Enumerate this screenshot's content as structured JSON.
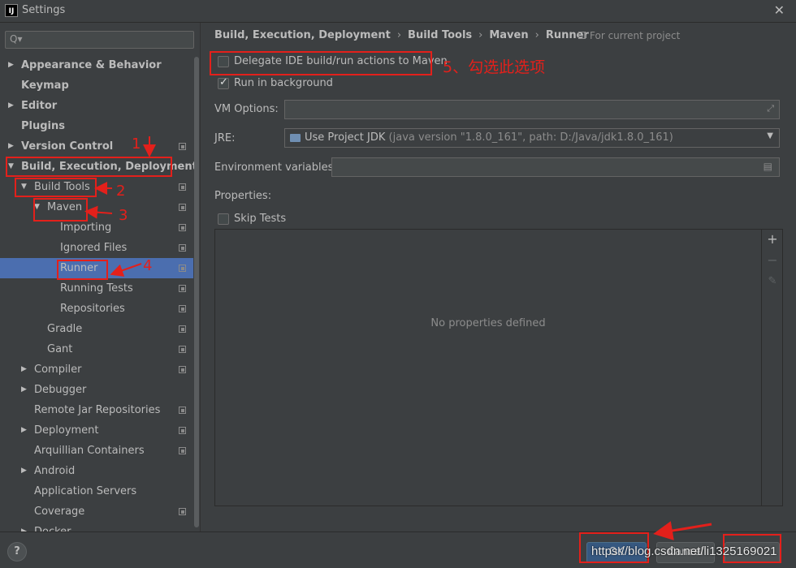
{
  "window": {
    "title": "Settings",
    "app_icon": "IJ",
    "close_glyph": "✕"
  },
  "search": {
    "placeholder": "",
    "icon": "Q▾"
  },
  "tree": [
    {
      "label": "Appearance & Behavior",
      "arrow": "▶",
      "bold": true,
      "copy": false
    },
    {
      "label": "Keymap",
      "arrow": "",
      "bold": true,
      "copy": false
    },
    {
      "label": "Editor",
      "arrow": "▶",
      "bold": true,
      "copy": false
    },
    {
      "label": "Plugins",
      "arrow": "",
      "bold": true,
      "copy": false
    },
    {
      "label": "Version Control",
      "arrow": "▶",
      "bold": true,
      "copy": true
    },
    {
      "label": "Build, Execution, Deployment",
      "arrow": "▼",
      "bold": true,
      "copy": false
    },
    {
      "label": "Build Tools",
      "arrow": "▼",
      "bold": false,
      "copy": true
    },
    {
      "label": "Maven",
      "arrow": "▼",
      "bold": false,
      "copy": true
    },
    {
      "label": "Importing",
      "arrow": "",
      "bold": false,
      "copy": true
    },
    {
      "label": "Ignored Files",
      "arrow": "",
      "bold": false,
      "copy": true
    },
    {
      "label": "Runner",
      "arrow": "",
      "bold": false,
      "copy": true,
      "selected": true
    },
    {
      "label": "Running Tests",
      "arrow": "",
      "bold": false,
      "copy": true
    },
    {
      "label": "Repositories",
      "arrow": "",
      "bold": false,
      "copy": true
    },
    {
      "label": "Gradle",
      "arrow": "",
      "bold": false,
      "copy": true
    },
    {
      "label": "Gant",
      "arrow": "",
      "bold": false,
      "copy": true
    },
    {
      "label": "Compiler",
      "arrow": "▶",
      "bold": false,
      "copy": true
    },
    {
      "label": "Debugger",
      "arrow": "▶",
      "bold": false,
      "copy": false
    },
    {
      "label": "Remote Jar Repositories",
      "arrow": "",
      "bold": false,
      "copy": true
    },
    {
      "label": "Deployment",
      "arrow": "▶",
      "bold": false,
      "copy": true
    },
    {
      "label": "Arquillian Containers",
      "arrow": "",
      "bold": false,
      "copy": true
    },
    {
      "label": "Android",
      "arrow": "▶",
      "bold": false,
      "copy": false
    },
    {
      "label": "Application Servers",
      "arrow": "",
      "bold": false,
      "copy": false
    },
    {
      "label": "Coverage",
      "arrow": "",
      "bold": false,
      "copy": true
    },
    {
      "label": "Docker",
      "arrow": "▶",
      "bold": false,
      "copy": false
    }
  ],
  "breadcrumb": [
    "Build, Execution, Deployment",
    "Build Tools",
    "Maven",
    "Runner"
  ],
  "breadcrumb_sep": "›",
  "for_project": "For current project",
  "delegate": {
    "label": "Delegate IDE build/run actions to Maven",
    "checked": false
  },
  "run_background": {
    "label": "Run in background",
    "checked": true
  },
  "vm_options": {
    "label": "VM Options:",
    "value": "",
    "expand_icon": "⤢"
  },
  "jre": {
    "label": "JRE:",
    "name": "Use Project JDK",
    "detail": "(java version \"1.8.0_161\", path: D:/Java/jdk1.8.0_161)",
    "caret": "▼"
  },
  "env": {
    "label": "Environment variables:",
    "value": "",
    "icon": "▤"
  },
  "properties": {
    "label": "Properties:",
    "empty_text": "No properties defined",
    "add": "+",
    "remove": "−",
    "edit": "✎"
  },
  "skip_tests": {
    "label": "Skip Tests",
    "checked": false
  },
  "footer": {
    "help": "?",
    "ok": "OK",
    "cancel": "Cancel",
    "apply": ""
  },
  "annotations": {
    "n1": "1",
    "n2": "2",
    "n3": "3",
    "n4": "4",
    "step5": "5、勾选此选项",
    "watermark": "https://blog.csdn.net/li1325169021"
  },
  "colors": {
    "annotation_red": "#e3201b",
    "selection_blue": "#4b6eaf",
    "primary_button": "#365880"
  }
}
